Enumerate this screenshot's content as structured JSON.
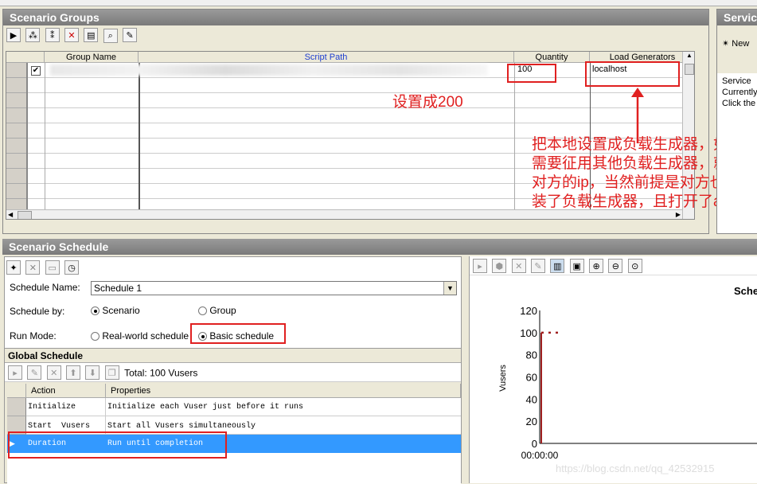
{
  "scenario_groups": {
    "title": "Scenario Groups",
    "columns": [
      "Group Name",
      "Script Path",
      "Quantity",
      "Load Generators"
    ],
    "row1": {
      "quantity": "100",
      "load_generator": "localhost"
    },
    "annotation_quantity": "设置成200",
    "annotation_lg": "把本地设置成负载生成器，如果需要征用其他负载生成器，就写对方的ip，当然前提是对方也安装了负载生成器，且打开了agent"
  },
  "service_panel": {
    "title": "Servic",
    "new_label": "New",
    "line1": "Service",
    "line2": "Currently",
    "line3": "Click the"
  },
  "scenario_schedule": {
    "title": "Scenario Schedule",
    "schedule_name_label": "Schedule Name:",
    "schedule_name_value": "Schedule 1",
    "schedule_by_label": "Schedule by:",
    "opt_scenario": "Scenario",
    "opt_group": "Group",
    "run_mode_label": "Run Mode:",
    "opt_realworld": "Real-world schedule",
    "opt_basic": "Basic schedule"
  },
  "global_schedule": {
    "title": "Global Schedule",
    "total": "Total: 100 Vusers",
    "columns": [
      "Action",
      "Properties"
    ],
    "rows": [
      {
        "action": "Initialize",
        "properties": "Initialize each Vuser just before it runs"
      },
      {
        "action": "Start  Vusers",
        "properties": "Start all Vusers simultaneously"
      },
      {
        "action": "Duration",
        "properties": "Run until completion"
      }
    ]
  },
  "chart_data": {
    "type": "line",
    "title": "Sche",
    "ylabel": "Vusers",
    "yticks": [
      "120",
      "100",
      "80",
      "60",
      "40",
      "20",
      "0"
    ],
    "ylim": [
      0,
      120
    ],
    "xtick": "00:00:00",
    "series": [
      {
        "values": [
          0,
          100,
          100
        ]
      }
    ]
  },
  "watermark": "https://blog.csdn.net/qq_42532915",
  "colors": {
    "accent_red": "#e02020",
    "selected_row": "#3399ff"
  }
}
